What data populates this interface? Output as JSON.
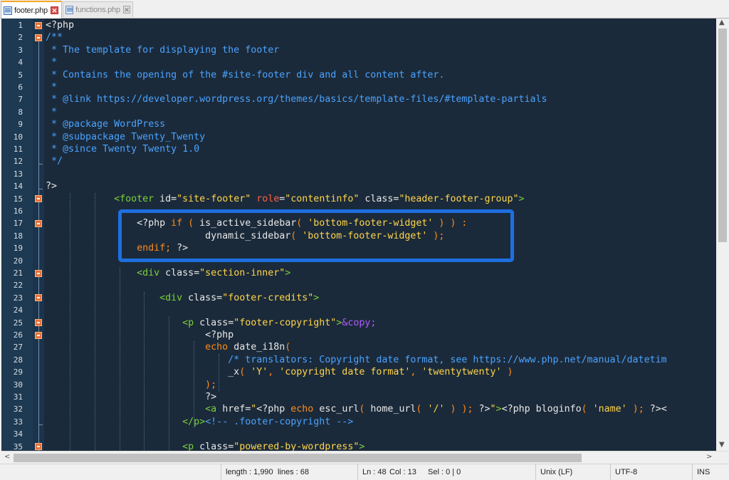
{
  "tabs": [
    {
      "label": "footer.php",
      "close": "✕"
    },
    {
      "label": "functions.php",
      "close": "✕"
    }
  ],
  "code_lines": [
    {
      "n": "1",
      "fold": "box",
      "tokens": [
        {
          "c": "t-php",
          "t": "<?php"
        }
      ]
    },
    {
      "n": "2",
      "fold": "box",
      "tokens": [
        {
          "c": "t-cmt",
          "t": "/**"
        }
      ]
    },
    {
      "n": "3",
      "tokens": [
        {
          "c": "t-cmt",
          "t": " * The template for displaying the footer"
        }
      ]
    },
    {
      "n": "4",
      "tokens": [
        {
          "c": "t-cmt",
          "t": " *"
        }
      ]
    },
    {
      "n": "5",
      "tokens": [
        {
          "c": "t-cmt",
          "t": " * Contains the opening of the #site-footer div and all content after."
        }
      ]
    },
    {
      "n": "6",
      "tokens": [
        {
          "c": "t-cmt",
          "t": " *"
        }
      ]
    },
    {
      "n": "7",
      "tokens": [
        {
          "c": "t-cmt",
          "t": " * @link https://developer.wordpress.org/themes/basics/template-files/#template-partials"
        }
      ]
    },
    {
      "n": "8",
      "tokens": [
        {
          "c": "t-cmt",
          "t": " *"
        }
      ]
    },
    {
      "n": "9",
      "tokens": [
        {
          "c": "t-cmt",
          "t": " * @package WordPress"
        }
      ]
    },
    {
      "n": "10",
      "tokens": [
        {
          "c": "t-cmt",
          "t": " * @subpackage Twenty_Twenty"
        }
      ]
    },
    {
      "n": "11",
      "tokens": [
        {
          "c": "t-cmt",
          "t": " * @since Twenty Twenty 1.0"
        }
      ]
    },
    {
      "n": "12",
      "fold": "end",
      "tokens": [
        {
          "c": "t-cmt",
          "t": " */"
        }
      ]
    },
    {
      "n": "13",
      "tokens": []
    },
    {
      "n": "14",
      "fold": "end",
      "tokens": [
        {
          "c": "t-php",
          "t": "?>"
        }
      ]
    },
    {
      "n": "15",
      "fold": "box",
      "tokens": [
        {
          "c": "t-php",
          "t": "            "
        },
        {
          "c": "t-tag",
          "t": "<footer "
        },
        {
          "c": "t-attr",
          "t": "id="
        },
        {
          "c": "t-aval",
          "t": "\"site-footer\" "
        },
        {
          "c": "t-role",
          "t": "role"
        },
        {
          "c": "t-attr",
          "t": "="
        },
        {
          "c": "t-aval",
          "t": "\"contentinfo\" "
        },
        {
          "c": "t-attr",
          "t": "class="
        },
        {
          "c": "t-aval",
          "t": "\"header-footer-group\""
        },
        {
          "c": "t-tag",
          "t": ">"
        }
      ]
    },
    {
      "n": "16",
      "tokens": []
    },
    {
      "n": "17",
      "fold": "box",
      "tokens": [
        {
          "c": "t-php",
          "t": "                <?php "
        },
        {
          "c": "t-kw",
          "t": "if ( "
        },
        {
          "c": "t-fn",
          "t": "is_active_sidebar"
        },
        {
          "c": "t-kw",
          "t": "( "
        },
        {
          "c": "t-str",
          "t": "'bottom-footer-widget'"
        },
        {
          "c": "t-kw",
          "t": " ) ) :"
        }
      ]
    },
    {
      "n": "18",
      "tokens": [
        {
          "c": "t-php",
          "t": "                            dynamic_sidebar"
        },
        {
          "c": "t-kw",
          "t": "( "
        },
        {
          "c": "t-str",
          "t": "'bottom-footer-widget'"
        },
        {
          "c": "t-kw",
          "t": " );"
        }
      ]
    },
    {
      "n": "19",
      "tokens": [
        {
          "c": "t-kw",
          "t": "                endif; "
        },
        {
          "c": "t-php",
          "t": "?>"
        }
      ]
    },
    {
      "n": "20",
      "tokens": []
    },
    {
      "n": "21",
      "fold": "box",
      "tokens": [
        {
          "c": "t-php",
          "t": "                "
        },
        {
          "c": "t-tag",
          "t": "<div "
        },
        {
          "c": "t-attr",
          "t": "class="
        },
        {
          "c": "t-aval",
          "t": "\"section-inner\""
        },
        {
          "c": "t-tag",
          "t": ">"
        }
      ]
    },
    {
      "n": "22",
      "tokens": []
    },
    {
      "n": "23",
      "fold": "box",
      "tokens": [
        {
          "c": "t-php",
          "t": "                    "
        },
        {
          "c": "t-tag",
          "t": "<div "
        },
        {
          "c": "t-attr",
          "t": "class="
        },
        {
          "c": "t-aval",
          "t": "\"footer-credits\""
        },
        {
          "c": "t-tag",
          "t": ">"
        }
      ]
    },
    {
      "n": "24",
      "tokens": []
    },
    {
      "n": "25",
      "fold": "box",
      "tokens": [
        {
          "c": "t-php",
          "t": "                        "
        },
        {
          "c": "t-tag",
          "t": "<p "
        },
        {
          "c": "t-attr",
          "t": "class="
        },
        {
          "c": "t-aval",
          "t": "\"footer-copyright\""
        },
        {
          "c": "t-tag",
          "t": ">"
        },
        {
          "c": "t-ent",
          "t": "&copy;"
        }
      ]
    },
    {
      "n": "26",
      "fold": "box",
      "tokens": [
        {
          "c": "t-php",
          "t": "                            <?php"
        }
      ]
    },
    {
      "n": "27",
      "tokens": [
        {
          "c": "t-kw",
          "t": "                            echo "
        },
        {
          "c": "t-fn",
          "t": "date_i18n"
        },
        {
          "c": "t-kw",
          "t": "("
        }
      ]
    },
    {
      "n": "28",
      "tokens": [
        {
          "c": "t-cmt",
          "t": "                                /* translators: Copyright date format, see https://www.php.net/manual/datetim"
        }
      ]
    },
    {
      "n": "29",
      "tokens": [
        {
          "c": "t-php",
          "t": "                                _x"
        },
        {
          "c": "t-kw",
          "t": "( "
        },
        {
          "c": "t-str",
          "t": "'Y'"
        },
        {
          "c": "t-kw",
          "t": ", "
        },
        {
          "c": "t-str",
          "t": "'copyright date format'"
        },
        {
          "c": "t-kw",
          "t": ", "
        },
        {
          "c": "t-str",
          "t": "'twentytwenty'"
        },
        {
          "c": "t-kw",
          "t": " )"
        }
      ]
    },
    {
      "n": "30",
      "tokens": [
        {
          "c": "t-kw",
          "t": "                            );"
        }
      ]
    },
    {
      "n": "31",
      "tokens": [
        {
          "c": "t-php",
          "t": "                            ?>"
        }
      ]
    },
    {
      "n": "32",
      "tokens": [
        {
          "c": "t-php",
          "t": "                            "
        },
        {
          "c": "t-tag",
          "t": "<a "
        },
        {
          "c": "t-attr",
          "t": "href="
        },
        {
          "c": "t-aval",
          "t": "\""
        },
        {
          "c": "t-php",
          "t": "<?php "
        },
        {
          "c": "t-kw",
          "t": "echo "
        },
        {
          "c": "t-fn",
          "t": "esc_url"
        },
        {
          "c": "t-kw",
          "t": "( "
        },
        {
          "c": "t-fn",
          "t": "home_url"
        },
        {
          "c": "t-kw",
          "t": "( "
        },
        {
          "c": "t-str",
          "t": "'/'"
        },
        {
          "c": "t-kw",
          "t": " ) ); "
        },
        {
          "c": "t-php",
          "t": "?>"
        },
        {
          "c": "t-aval",
          "t": "\""
        },
        {
          "c": "t-tag",
          "t": ">"
        },
        {
          "c": "t-php",
          "t": "<?php bloginfo"
        },
        {
          "c": "t-kw",
          "t": "( "
        },
        {
          "c": "t-str",
          "t": "'name'"
        },
        {
          "c": "t-kw",
          "t": " ); "
        },
        {
          "c": "t-php",
          "t": "?><"
        }
      ]
    },
    {
      "n": "33",
      "fold": "end",
      "tokens": [
        {
          "c": "t-php",
          "t": "                        "
        },
        {
          "c": "t-tag",
          "t": "</p>"
        },
        {
          "c": "t-cmt",
          "t": "<!-- .footer-copyright -->"
        }
      ]
    },
    {
      "n": "34",
      "tokens": []
    },
    {
      "n": "35",
      "fold": "box",
      "tokens": [
        {
          "c": "t-php",
          "t": "                        "
        },
        {
          "c": "t-tag",
          "t": "<p "
        },
        {
          "c": "t-attr",
          "t": "class="
        },
        {
          "c": "t-aval",
          "t": "\"powered-by-wordpress\""
        },
        {
          "c": "t-tag",
          "t": ">"
        }
      ]
    }
  ],
  "status": {
    "length": "length : 1,990",
    "lines": "lines : 68",
    "ln": "Ln : 48",
    "col": "Col : 13",
    "sel": "Sel : 0 | 0",
    "eol": "Unix (LF)",
    "encoding": "UTF-8",
    "mode": "INS"
  },
  "scroll": {
    "left_arrow": "<",
    "right_arrow": ">"
  },
  "colors": {
    "highlight_border": "#1e6fe0",
    "editor_bg": "#1b2a3a",
    "active_tab_accent": "#f5a623"
  }
}
